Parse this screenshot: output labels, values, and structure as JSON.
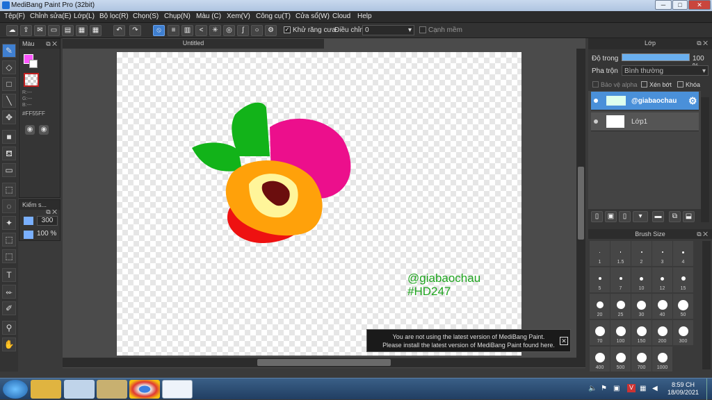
{
  "window": {
    "title": "MediBang Paint Pro (32bit)",
    "min": "─",
    "max": "□",
    "close": "✕"
  },
  "menu": [
    "Tệp(F)",
    "Chỉnh sửa(E)",
    "Lớp(L)",
    "Bộ lọc(R)",
    "Chọn(S)",
    "Chụp(N)",
    "Màu (C)",
    "Xem(V)",
    "Công cụ(T)",
    "Cửa sổ(W)",
    "Cloud",
    "Help"
  ],
  "toolbar": {
    "antialias_label": "Khử răng cưa",
    "adjust_label": "Điều chỉnh",
    "adjust_value": "0",
    "edge_label": "Cạnh mềm"
  },
  "color_panel": {
    "title": "Màu",
    "r": "R:---",
    "g": "G:---",
    "b": "B:---",
    "hex": "#FF55FF",
    "fg": "#ff55ff"
  },
  "size_panel": {
    "title": "Kiếm s...",
    "size": "300",
    "opacity": "100 %"
  },
  "doc": {
    "tab": "Untitled",
    "watermark1": "@giabaochau",
    "watermark2": "#HD247"
  },
  "layer_panel": {
    "title": "Lớp",
    "opacity_label": "Độ trong",
    "opacity_value": "100 %",
    "blend_label": "Pha trộn",
    "blend_value": "Bình thường",
    "protect_alpha": "Bảo vệ alpha",
    "clip": "Xén bớt",
    "lock": "Khóa",
    "layers": [
      {
        "name": "@giabaochau",
        "selected": true
      },
      {
        "name": "Lớp1",
        "selected": false
      }
    ]
  },
  "brush_panel": {
    "title": "Brush Size",
    "sizes": [
      "1",
      "1.5",
      "2",
      "3",
      "4",
      "5",
      "7",
      "10",
      "12",
      "15",
      "20",
      "25",
      "30",
      "40",
      "50",
      "70",
      "100",
      "150",
      "200",
      "300",
      "400",
      "500",
      "700",
      "1000"
    ]
  },
  "notification": {
    "line1": "You are not using the latest version of MediBang Paint.",
    "line2": "Please install the latest version of MediBang Paint found here."
  },
  "taskbar": {
    "time": "8:59 CH",
    "date": "18/09/2021"
  }
}
